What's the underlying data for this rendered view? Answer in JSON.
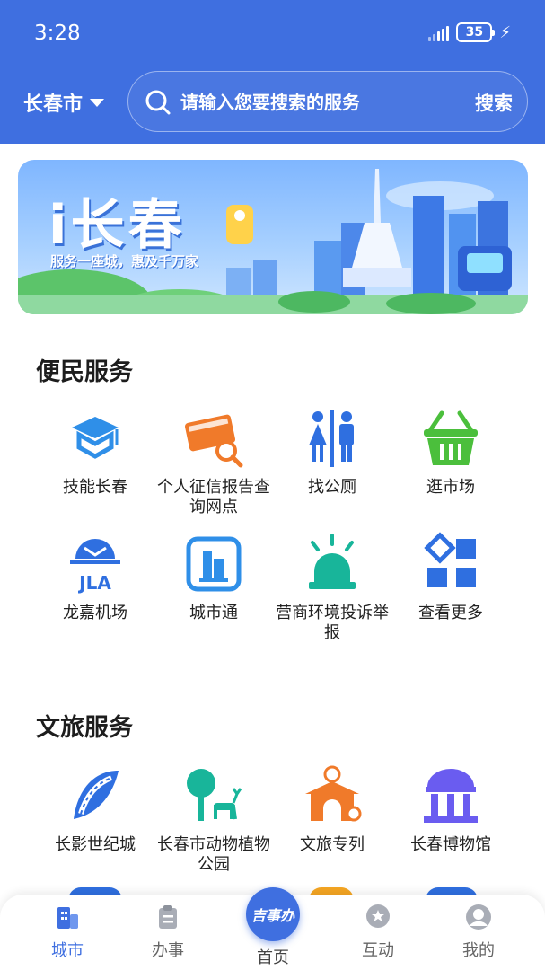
{
  "status_bar": {
    "time": "3:28",
    "battery": "35"
  },
  "header": {
    "city": "长春市",
    "search_placeholder": "请输入您要搜索的服务",
    "search_button": "搜索"
  },
  "banner": {
    "title": "i长春",
    "subtitle": "服务一座城，惠及千万家"
  },
  "convenience": {
    "title": "便民服务",
    "items": [
      {
        "label": "技能长春",
        "icon": "skills-cap-icon"
      },
      {
        "label": "个人征信报告查询网点",
        "icon": "credit-card-search-icon"
      },
      {
        "label": "找公厕",
        "icon": "restroom-icon"
      },
      {
        "label": "逛市场",
        "icon": "market-basket-icon"
      },
      {
        "label": "龙嘉机场",
        "icon": "jla-airport-icon"
      },
      {
        "label": "城市通",
        "icon": "city-pass-icon"
      },
      {
        "label": "营商环境投诉举报",
        "icon": "alarm-siren-icon"
      },
      {
        "label": "查看更多",
        "icon": "more-grid-icon"
      }
    ]
  },
  "culture": {
    "title": "文旅服务",
    "items": [
      {
        "label": "长影世纪城",
        "icon": "film-city-icon"
      },
      {
        "label": "长春市动物植物公园",
        "icon": "zoo-tree-deer-icon"
      },
      {
        "label": "文旅专列",
        "icon": "culture-gate-icon"
      },
      {
        "label": "长春博物馆",
        "icon": "museum-icon"
      }
    ]
  },
  "bottom_nav": {
    "items": [
      {
        "label": "城市",
        "icon": "city-building-icon",
        "active": true
      },
      {
        "label": "办事",
        "icon": "clipboard-icon",
        "active": false
      },
      {
        "label": "首页",
        "icon": "jishiban-logo-icon",
        "active": false
      },
      {
        "label": "互动",
        "icon": "chat-star-icon",
        "active": false
      },
      {
        "label": "我的",
        "icon": "user-avatar-icon",
        "active": false
      }
    ],
    "home_logo_text": "吉事办"
  },
  "colors": {
    "primary": "#3f6fe0",
    "orange": "#f07a2a",
    "blue": "#2f6fe0",
    "teal": "#18b59a",
    "green": "#4bbf3c",
    "purple": "#6a5cf0"
  }
}
